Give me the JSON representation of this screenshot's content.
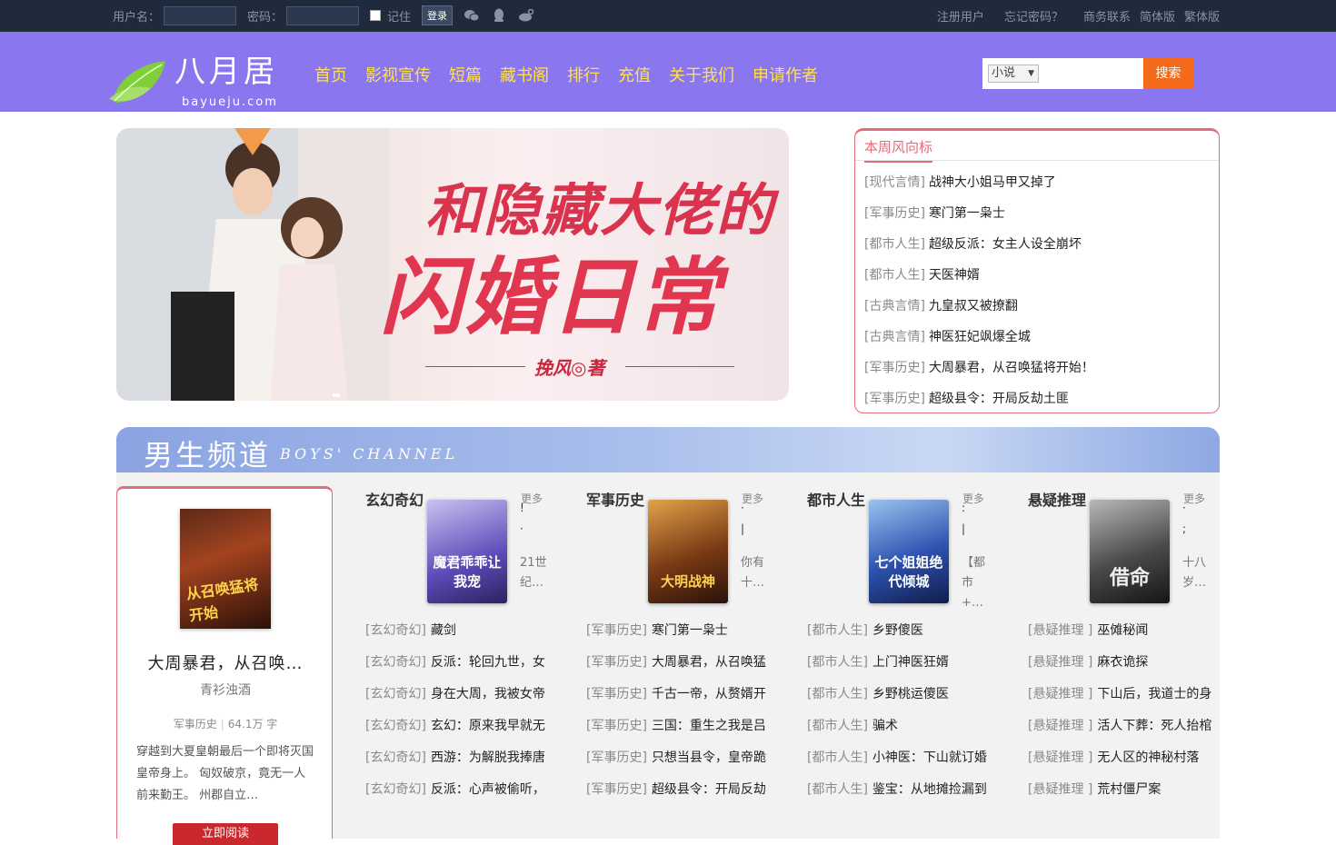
{
  "topbar": {
    "username_label": "用户名：",
    "password_label": "密码：",
    "remember_label": "记住",
    "login_button": "登录",
    "links": [
      "注册用户",
      "忘记密码？",
      "商务联系",
      "简体版",
      "繁体版"
    ]
  },
  "header": {
    "logo_cn": "八月居",
    "logo_en": "bayueju.com",
    "nav": [
      "首页",
      "影视宣传",
      "短篇",
      "藏书阁",
      "排行",
      "充值",
      "关于我们",
      "申请作者"
    ],
    "search_select": "小说",
    "search_button": "搜索"
  },
  "banner": {
    "title_line1": "和隐藏大佬的",
    "title_line2": "闪婚日常",
    "author": "挽风◎著"
  },
  "weekly": {
    "heading": "本周风向标",
    "items": [
      {
        "cat": "[现代言情]",
        "title": "战神大小姐马甲又掉了"
      },
      {
        "cat": "[军事历史]",
        "title": "寒门第一枭士"
      },
      {
        "cat": "[都市人生]",
        "title": "超级反派：女主人设全崩坏"
      },
      {
        "cat": "[都市人生]",
        "title": "天医神婿"
      },
      {
        "cat": "[古典言情]",
        "title": "九皇叔又被撩翻"
      },
      {
        "cat": "[古典言情]",
        "title": "神医狂妃飒爆全城"
      },
      {
        "cat": "[军事历史]",
        "title": "大周暴君，从召唤猛将开始！"
      },
      {
        "cat": "[军事历史]",
        "title": "超级县令：开局反劫土匪"
      }
    ]
  },
  "channel": {
    "title_cn": "男生频道",
    "title_en": "BOYS' CHANNEL"
  },
  "featured": {
    "cover_text": "从召唤猛将开始",
    "name": "大周暴君，从召唤…",
    "author": "青衫浊酒",
    "category": "军事历史",
    "words": "64.1万 字",
    "desc": "穿越到大夏皇朝最后一个即将灭国皇帝身上。 匈奴破京，竟无一人前来勤王。 州郡自立…",
    "read_button": "立即阅读"
  },
  "columns": [
    {
      "name": "玄幻奇幻",
      "more": "更多",
      "cover_text": "魔君乖乖让我宠",
      "cover_color": "#7a6ad0",
      "mark1": "!",
      "mark2": "·",
      "snippet": "21世纪…",
      "items": [
        {
          "cat": "[玄幻奇幻]",
          "title": "藏剑"
        },
        {
          "cat": "[玄幻奇幻]",
          "title": "反派：轮回九世，女"
        },
        {
          "cat": "[玄幻奇幻]",
          "title": "身在大周，我被女帝"
        },
        {
          "cat": "[玄幻奇幻]",
          "title": "玄幻：原来我早就无"
        },
        {
          "cat": "[玄幻奇幻]",
          "title": "西游：为解脱我捧唐"
        },
        {
          "cat": "[玄幻奇幻]",
          "title": "反派：心声被偷听，"
        }
      ]
    },
    {
      "name": "军事历史",
      "more": "更多",
      "cover_text": "大明战神",
      "cover_color": "#6b3a1a",
      "mark1": "·",
      "mark2": "|",
      "snippet": "你有十…",
      "items": [
        {
          "cat": "[军事历史]",
          "title": "寒门第一枭士"
        },
        {
          "cat": "[军事历史]",
          "title": "大周暴君，从召唤猛"
        },
        {
          "cat": "[军事历史]",
          "title": "千古一帝，从赘婿开"
        },
        {
          "cat": "[军事历史]",
          "title": "三国：重生之我是吕"
        },
        {
          "cat": "[军事历史]",
          "title": "只想当县令，皇帝跪"
        },
        {
          "cat": "[军事历史]",
          "title": "超级县令：开局反劫"
        }
      ]
    },
    {
      "name": "都市人生",
      "more": "更多",
      "cover_text": "七个姐姐绝代倾城",
      "cover_color": "#2a4aa0",
      "mark1": ":",
      "mark2": "|",
      "snippet": "【都市+…",
      "items": [
        {
          "cat": "[都市人生]",
          "title": "乡野傻医"
        },
        {
          "cat": "[都市人生]",
          "title": "上门神医狂婿"
        },
        {
          "cat": "[都市人生]",
          "title": "乡野桃运傻医"
        },
        {
          "cat": "[都市人生]",
          "title": "骗术"
        },
        {
          "cat": "[都市人生]",
          "title": "小神医：下山就订婚"
        },
        {
          "cat": "[都市人生]",
          "title": "鉴宝：从地摊捡漏到"
        }
      ]
    },
    {
      "name": "悬疑推理",
      "more": "更多",
      "cover_text": "借命",
      "cover_color": "#3a3a3a",
      "mark1": "·",
      "mark2": ";",
      "snippet": "十八岁…",
      "items": [
        {
          "cat": "[悬疑推理 ]",
          "title": "巫傩秘闻"
        },
        {
          "cat": "[悬疑推理 ]",
          "title": "麻衣诡探"
        },
        {
          "cat": "[悬疑推理 ]",
          "title": "下山后，我道士的身"
        },
        {
          "cat": "[悬疑推理 ]",
          "title": "活人下葬：死人抬棺"
        },
        {
          "cat": "[悬疑推理 ]",
          "title": "无人区的神秘村落"
        },
        {
          "cat": "[悬疑推理 ]",
          "title": "荒村僵尸案"
        }
      ]
    }
  ]
}
